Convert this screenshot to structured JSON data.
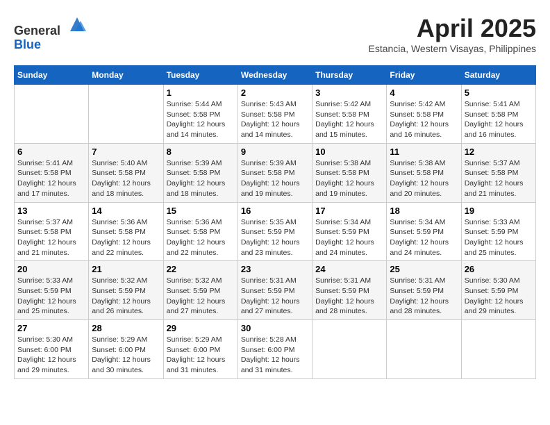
{
  "header": {
    "logo_line1": "General",
    "logo_line2": "Blue",
    "month_title": "April 2025",
    "location": "Estancia, Western Visayas, Philippines"
  },
  "weekdays": [
    "Sunday",
    "Monday",
    "Tuesday",
    "Wednesday",
    "Thursday",
    "Friday",
    "Saturday"
  ],
  "weeks": [
    [
      {
        "day": "",
        "info": ""
      },
      {
        "day": "",
        "info": ""
      },
      {
        "day": "1",
        "info": "Sunrise: 5:44 AM\nSunset: 5:58 PM\nDaylight: 12 hours and 14 minutes."
      },
      {
        "day": "2",
        "info": "Sunrise: 5:43 AM\nSunset: 5:58 PM\nDaylight: 12 hours and 14 minutes."
      },
      {
        "day": "3",
        "info": "Sunrise: 5:42 AM\nSunset: 5:58 PM\nDaylight: 12 hours and 15 minutes."
      },
      {
        "day": "4",
        "info": "Sunrise: 5:42 AM\nSunset: 5:58 PM\nDaylight: 12 hours and 16 minutes."
      },
      {
        "day": "5",
        "info": "Sunrise: 5:41 AM\nSunset: 5:58 PM\nDaylight: 12 hours and 16 minutes."
      }
    ],
    [
      {
        "day": "6",
        "info": "Sunrise: 5:41 AM\nSunset: 5:58 PM\nDaylight: 12 hours and 17 minutes."
      },
      {
        "day": "7",
        "info": "Sunrise: 5:40 AM\nSunset: 5:58 PM\nDaylight: 12 hours and 18 minutes."
      },
      {
        "day": "8",
        "info": "Sunrise: 5:39 AM\nSunset: 5:58 PM\nDaylight: 12 hours and 18 minutes."
      },
      {
        "day": "9",
        "info": "Sunrise: 5:39 AM\nSunset: 5:58 PM\nDaylight: 12 hours and 19 minutes."
      },
      {
        "day": "10",
        "info": "Sunrise: 5:38 AM\nSunset: 5:58 PM\nDaylight: 12 hours and 19 minutes."
      },
      {
        "day": "11",
        "info": "Sunrise: 5:38 AM\nSunset: 5:58 PM\nDaylight: 12 hours and 20 minutes."
      },
      {
        "day": "12",
        "info": "Sunrise: 5:37 AM\nSunset: 5:58 PM\nDaylight: 12 hours and 21 minutes."
      }
    ],
    [
      {
        "day": "13",
        "info": "Sunrise: 5:37 AM\nSunset: 5:58 PM\nDaylight: 12 hours and 21 minutes."
      },
      {
        "day": "14",
        "info": "Sunrise: 5:36 AM\nSunset: 5:58 PM\nDaylight: 12 hours and 22 minutes."
      },
      {
        "day": "15",
        "info": "Sunrise: 5:36 AM\nSunset: 5:58 PM\nDaylight: 12 hours and 22 minutes."
      },
      {
        "day": "16",
        "info": "Sunrise: 5:35 AM\nSunset: 5:59 PM\nDaylight: 12 hours and 23 minutes."
      },
      {
        "day": "17",
        "info": "Sunrise: 5:34 AM\nSunset: 5:59 PM\nDaylight: 12 hours and 24 minutes."
      },
      {
        "day": "18",
        "info": "Sunrise: 5:34 AM\nSunset: 5:59 PM\nDaylight: 12 hours and 24 minutes."
      },
      {
        "day": "19",
        "info": "Sunrise: 5:33 AM\nSunset: 5:59 PM\nDaylight: 12 hours and 25 minutes."
      }
    ],
    [
      {
        "day": "20",
        "info": "Sunrise: 5:33 AM\nSunset: 5:59 PM\nDaylight: 12 hours and 25 minutes."
      },
      {
        "day": "21",
        "info": "Sunrise: 5:32 AM\nSunset: 5:59 PM\nDaylight: 12 hours and 26 minutes."
      },
      {
        "day": "22",
        "info": "Sunrise: 5:32 AM\nSunset: 5:59 PM\nDaylight: 12 hours and 27 minutes."
      },
      {
        "day": "23",
        "info": "Sunrise: 5:31 AM\nSunset: 5:59 PM\nDaylight: 12 hours and 27 minutes."
      },
      {
        "day": "24",
        "info": "Sunrise: 5:31 AM\nSunset: 5:59 PM\nDaylight: 12 hours and 28 minutes."
      },
      {
        "day": "25",
        "info": "Sunrise: 5:31 AM\nSunset: 5:59 PM\nDaylight: 12 hours and 28 minutes."
      },
      {
        "day": "26",
        "info": "Sunrise: 5:30 AM\nSunset: 5:59 PM\nDaylight: 12 hours and 29 minutes."
      }
    ],
    [
      {
        "day": "27",
        "info": "Sunrise: 5:30 AM\nSunset: 6:00 PM\nDaylight: 12 hours and 29 minutes."
      },
      {
        "day": "28",
        "info": "Sunrise: 5:29 AM\nSunset: 6:00 PM\nDaylight: 12 hours and 30 minutes."
      },
      {
        "day": "29",
        "info": "Sunrise: 5:29 AM\nSunset: 6:00 PM\nDaylight: 12 hours and 31 minutes."
      },
      {
        "day": "30",
        "info": "Sunrise: 5:28 AM\nSunset: 6:00 PM\nDaylight: 12 hours and 31 minutes."
      },
      {
        "day": "",
        "info": ""
      },
      {
        "day": "",
        "info": ""
      },
      {
        "day": "",
        "info": ""
      }
    ]
  ]
}
